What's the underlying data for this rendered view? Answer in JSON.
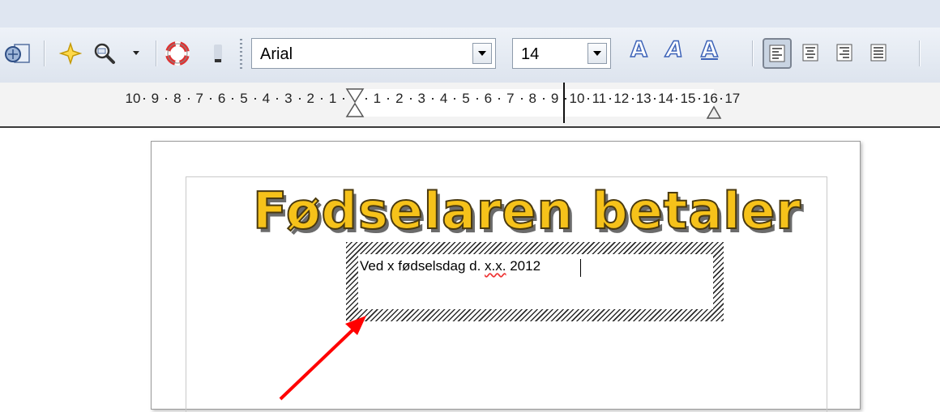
{
  "toolbar": {
    "font_name": "Arial",
    "font_size": "14",
    "icons": [
      "navigator-icon",
      "gallery-star-icon",
      "zoom-icon",
      "zoom-dropdown-icon",
      "help-lifebuoy-icon",
      "toolbar-options-icon"
    ],
    "fontwork_icons": [
      "fontwork-shape-icon",
      "fontwork-italic-icon",
      "fontwork-underline-icon"
    ],
    "align_icons": [
      "align-left-icon",
      "align-center-icon",
      "align-right-icon",
      "align-justify-icon"
    ]
  },
  "ruler": {
    "left_labels": [
      "10",
      "9",
      "8",
      "7",
      "6",
      "5",
      "4",
      "3",
      "2",
      "1"
    ],
    "right_labels": [
      "1",
      "2",
      "3",
      "4",
      "5",
      "6",
      "7",
      "8",
      "9",
      "10",
      "11",
      "12",
      "13",
      "14",
      "15",
      "16",
      "17"
    ]
  },
  "document": {
    "title": "Fødselaren betaler",
    "frame_text_before": "Ved x fødselsdag d. ",
    "frame_text_misspelled": "x.x.",
    "frame_text_after": " 2012"
  },
  "colors": {
    "title_fill": "#f6c21a",
    "annotation_arrow": "#ff0000",
    "fontwork_blue": "#3d63b8"
  }
}
